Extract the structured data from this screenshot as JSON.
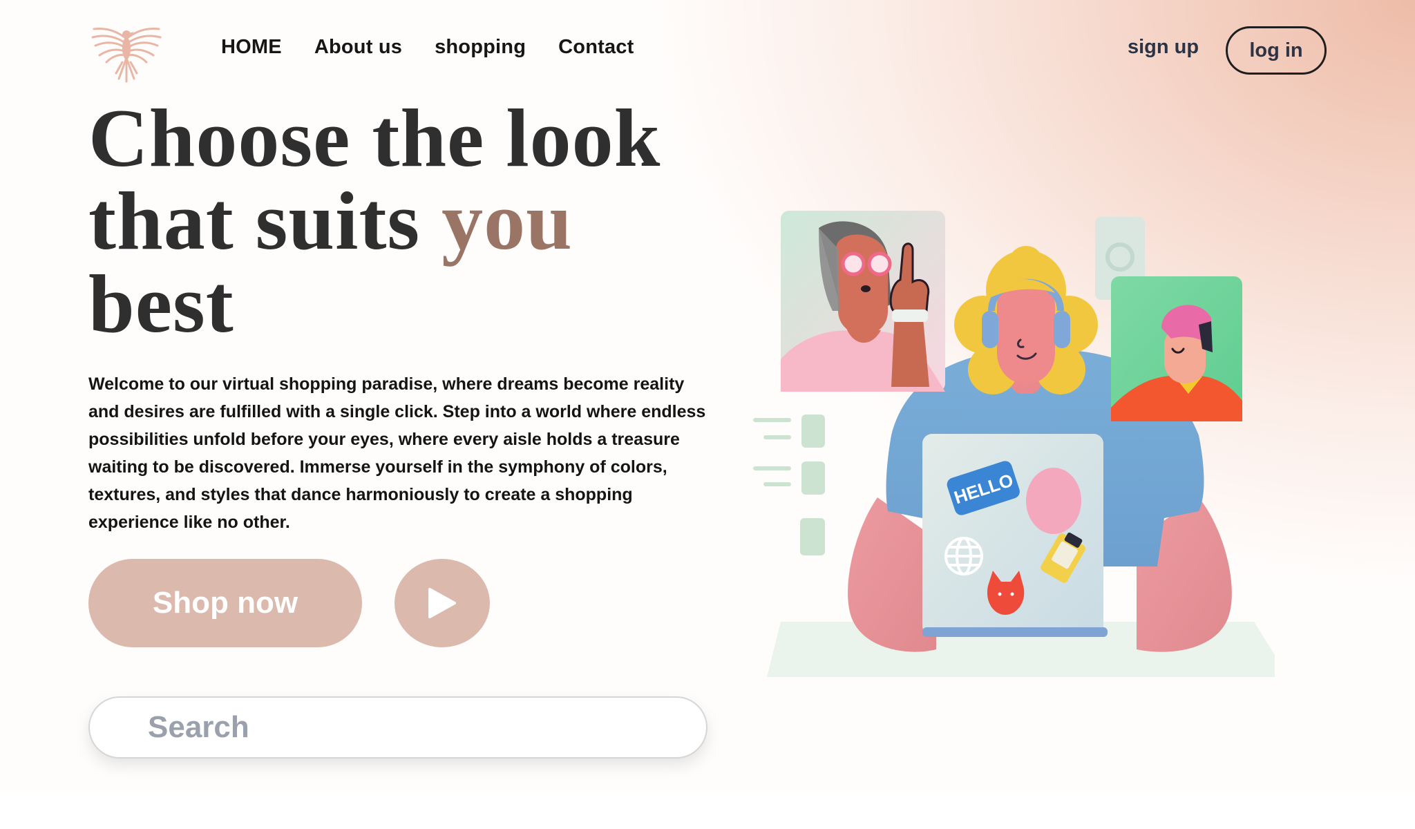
{
  "nav": {
    "items": [
      "HOME",
      "About us",
      "shopping",
      "Contact"
    ],
    "signup_label": "sign up",
    "login_label": "log in"
  },
  "hero": {
    "headline_line1": "Choose the look",
    "headline_line2_a": "that suits ",
    "headline_line2_b": "you",
    "headline_line3": "best",
    "description": "Welcome to our virtual shopping paradise, where dreams become reality and desires are fulfilled with a single click. Step into a world where endless possibilities unfold before your eyes, where every aisle holds a treasure waiting to be discovered. Immerse yourself in the symphony of colors, textures, and styles that dance harmoniously to create a shopping experience like no other.",
    "shop_label": "Shop now",
    "search_placeholder": "Search",
    "illustration_badge": "HELLO"
  },
  "icons": {
    "logo": "phoenix-logo-icon",
    "play": "play-icon"
  },
  "colors": {
    "accent": "#9a7566",
    "button": "#dbb9ad",
    "headline": "#2f2f2f",
    "gradient_peach": "#eebca8"
  }
}
